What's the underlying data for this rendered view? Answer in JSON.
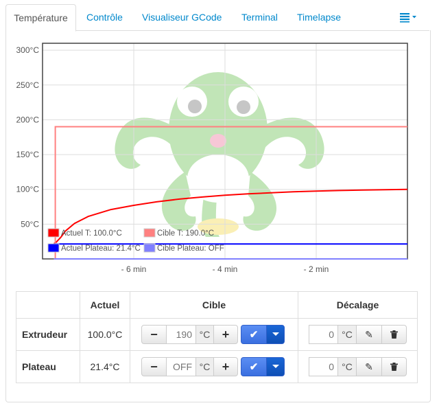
{
  "tabs": {
    "items": [
      {
        "label": "Température",
        "active": true
      },
      {
        "label": "Contrôle"
      },
      {
        "label": "Visualiseur GCode"
      },
      {
        "label": "Terminal"
      },
      {
        "label": "Timelapse"
      }
    ],
    "menu_icon": "list-icon"
  },
  "chart_data": {
    "type": "line",
    "ylabel_ticks": [
      "300°C",
      "250°C",
      "200°C",
      "150°C",
      "100°C",
      "50°C"
    ],
    "ylim": [
      0,
      310
    ],
    "xlim": [
      -8.0,
      0
    ],
    "x_ticks": [
      "- 6 min",
      "- 4 min",
      "- 2 min"
    ],
    "x_tick_values": [
      -6,
      -4,
      -2
    ],
    "series": [
      {
        "name": "Actuel T: 100.0°C",
        "color": "#ff0000",
        "x": [
          -7.75,
          -7.7,
          -7.6,
          -7.5,
          -7.3,
          -7.0,
          -6.5,
          -6.0,
          -5.5,
          -5.0,
          -4.5,
          -4.0,
          -3.5,
          -3.0,
          -2.5,
          -2.0,
          -1.5,
          -1.0,
          -0.5,
          0.0
        ],
        "y": [
          22,
          24,
          31,
          40,
          51,
          61,
          71,
          77,
          82,
          86,
          89,
          91.5,
          93.5,
          95,
          96.5,
          97.5,
          98.3,
          99,
          99.5,
          100
        ]
      },
      {
        "name": "Cible T: 190.0°C",
        "color": "#ff8080",
        "x": [
          -7.75,
          -7.72,
          -7.72,
          0.0
        ],
        "y": [
          0,
          0,
          190,
          190
        ]
      },
      {
        "name": "Actuel Plateau: 21.4°C",
        "color": "#0000ff",
        "x": [
          -7.75,
          -4.0,
          0.0
        ],
        "y": [
          21.4,
          21.4,
          21.4
        ]
      },
      {
        "name": "Cible Plateau: OFF",
        "color": "#8080ff",
        "x": [
          -7.75,
          0.0
        ],
        "y": [
          0,
          0
        ]
      }
    ],
    "legend": "bottom-left",
    "grid": true
  },
  "table": {
    "headers": {
      "actual": "Actuel",
      "target": "Cible",
      "offset": "Décalage"
    },
    "rows": [
      {
        "name": "Extrudeur",
        "actual": "100.0°C",
        "target_value": "190",
        "unit": "°C",
        "offset_value": "0"
      },
      {
        "name": "Plateau",
        "actual": "21.4°C",
        "target_value": "OFF",
        "unit": "°C",
        "offset_value": "0"
      }
    ]
  },
  "icons": {
    "minus": "minus-icon",
    "plus": "plus-icon",
    "check": "check-icon",
    "caret": "caret-down-icon",
    "edit": "pencil-icon",
    "delete": "trash-icon"
  }
}
